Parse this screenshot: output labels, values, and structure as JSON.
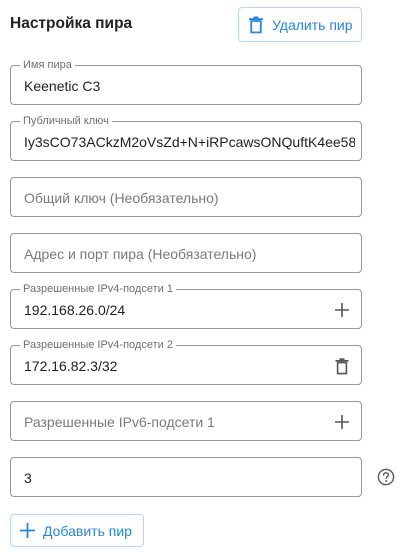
{
  "header": {
    "title": "Настройка пира",
    "delete_label": "Удалить пир"
  },
  "fields": {
    "peer_name": {
      "label": "Имя пира",
      "value": "Keenetic C3"
    },
    "public_key": {
      "label": "Публичный ключ",
      "value": "Iy3sCO73ACkzM2oVsZd+N+iRPcawsONQuftK4ee58"
    },
    "shared_key": {
      "placeholder": "Общий ключ (Необязательно)"
    },
    "peer_address": {
      "placeholder": "Адрес и порт пира (Необязательно)"
    },
    "ipv4_1": {
      "label": "Разрешенные IPv4-подсети 1",
      "value": "192.168.26.0/24"
    },
    "ipv4_2": {
      "label": "Разрешенные IPv4-подсети 2",
      "value": "172.16.82.3/32"
    },
    "ipv6_1": {
      "placeholder": "Разрешенные IPv6-подсети 1"
    },
    "keepalive": {
      "value": "3"
    }
  },
  "footer": {
    "add_label": "Добавить пир"
  },
  "icons": {
    "delete": "trash-icon",
    "add": "plus-icon",
    "help": "question-circle-icon"
  },
  "colors": {
    "accent": "#2b84d8",
    "border": "#9a9a9a",
    "label": "#6f6f6f"
  }
}
